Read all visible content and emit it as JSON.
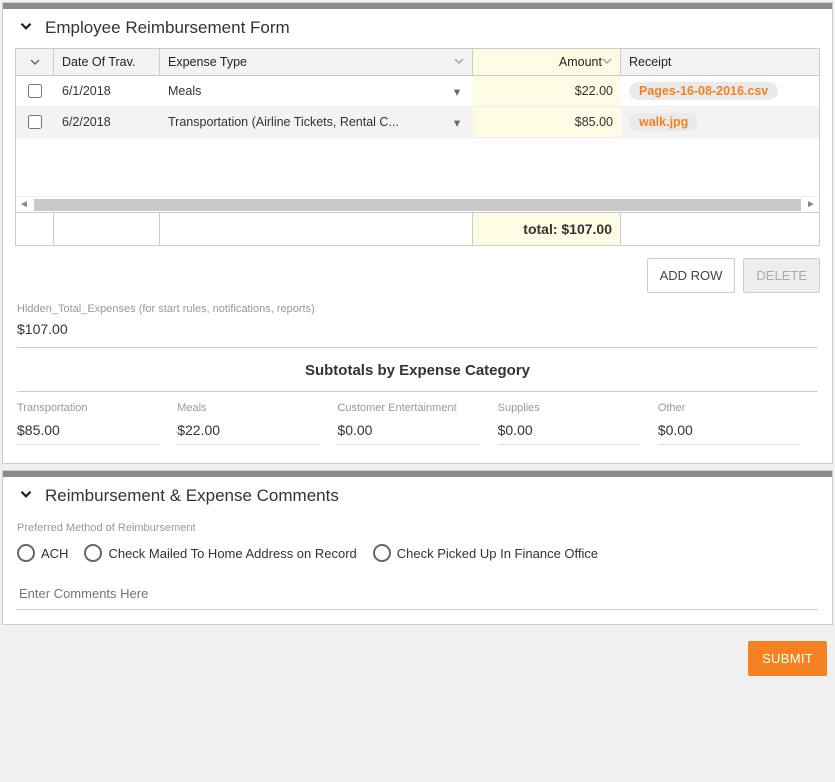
{
  "section1": {
    "title": "Employee Reimbursement Form",
    "columns": {
      "date": "Date Of Trav.",
      "type": "Expense Type",
      "amount": "Amount",
      "receipt": "Receipt"
    },
    "rows": [
      {
        "date": "6/1/2018",
        "type": "Meals",
        "amount": "$22.00",
        "receipt": "Pages-16-08-2016.csv"
      },
      {
        "date": "6/2/2018",
        "type": "Transportation (Airline Tickets, Rental C...",
        "amount": "$85.00",
        "receipt": "walk.jpg"
      }
    ],
    "total_label": "total: $107.00",
    "buttons": {
      "add": "ADD ROW",
      "delete": "DELETE"
    },
    "hidden_label": "Hidden_Total_Expenses (for start rules, notifications, reports)",
    "hidden_value": "$107.00",
    "subtotals_header": "Subtotals by Expense Category",
    "subtotals": [
      {
        "label": "Transportation",
        "value": "$85.00"
      },
      {
        "label": "Meals",
        "value": "$22.00"
      },
      {
        "label": "Customer Entertainment",
        "value": "$0.00"
      },
      {
        "label": "Supplies",
        "value": "$0.00"
      },
      {
        "label": "Other",
        "value": "$0.00"
      }
    ]
  },
  "section2": {
    "title": "Reimbursement & Expense Comments",
    "pref_label": "Preferred Method of Reimbursement",
    "options": [
      "ACH",
      "Check Mailed To Home Address on Record",
      "Check Picked Up In Finance Office"
    ],
    "comments_placeholder": "Enter Comments Here"
  },
  "submit": "SUBMIT",
  "colors": {
    "accent": "#f58220"
  }
}
